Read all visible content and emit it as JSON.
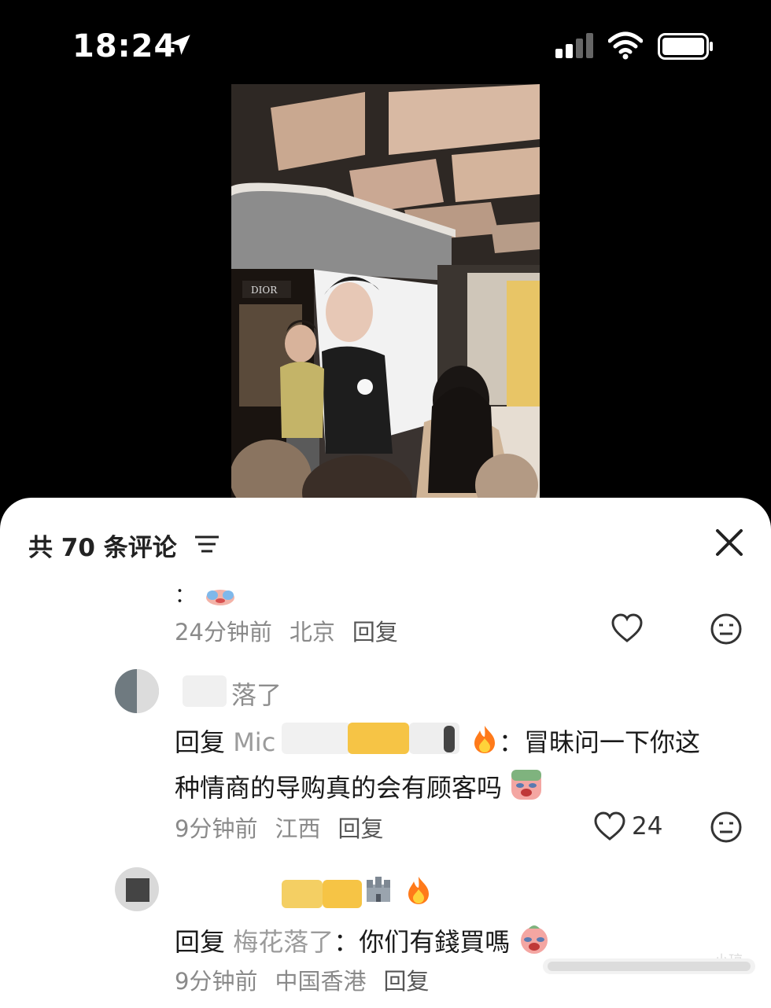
{
  "status_bar": {
    "time": "18:24",
    "icons": [
      "location-arrow-icon",
      "cellular-signal-icon",
      "wifi-icon",
      "battery-icon"
    ]
  },
  "photo": {
    "store_sign_left": "DIOR"
  },
  "comments_panel": {
    "title": "共 70 条评论",
    "icons": [
      "filter-icon",
      "close-icon"
    ],
    "comments": [
      {
        "body_prefix": "：",
        "time": "24分钟前",
        "location": "北京",
        "reply_label": "回复",
        "like_count": ""
      },
      {
        "username": "落了",
        "reply_prefix": "回复",
        "reply_to": "Mic",
        "body_line1": "：冒昧问一下你这",
        "body_line2": "种情商的导购真的会有顾客吗",
        "time": "9分钟前",
        "location": "江西",
        "reply_label": "回复",
        "like_count": "24"
      },
      {
        "username": "",
        "reply_prefix": "回复",
        "reply_to": "梅花落了",
        "body": "：你们有錢買嗎",
        "time": "9分钟前",
        "location": "中国香港",
        "reply_label": "回复",
        "like_count": ""
      }
    ],
    "watermark": "小琼"
  },
  "colors": {
    "panel_bg": "#ffffff",
    "meta_gray": "#8a8a8a",
    "accent_fire": "#ff7a1a",
    "blur_yellow": "#f6c445"
  }
}
